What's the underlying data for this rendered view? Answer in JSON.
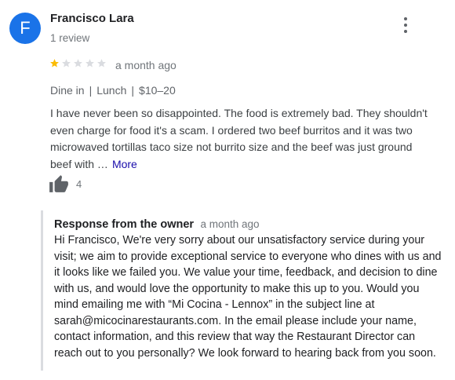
{
  "reviewer": {
    "initial": "F",
    "name": "Francisco Lara",
    "review_count": "1 review",
    "avatar_color": "#1a73e8"
  },
  "review": {
    "rating": 1,
    "max_rating": 5,
    "time": "a month ago",
    "meta": [
      "Dine in",
      "Lunch",
      "$10–20"
    ],
    "meta_separator": "|",
    "text": "I have never been so disappointed. The food is extremely bad. They shouldn't even charge for food it's a scam. I ordered two beef burritos and it was two microwaved tortillas taco size not burrito size and the beef was just ground beef with …",
    "more_label": "More",
    "likes": "4"
  },
  "owner_response": {
    "title": "Response from the owner",
    "time": "a month ago",
    "text": "Hi Francisco, We're very sorry about our unsatisfactory service during your visit; we aim to provide exceptional service to everyone who dines with us and it looks like we failed you. We value your time, feedback, and decision to dine with us, and would love the opportunity to make this up to you. Would you mind emailing me with “Mi Cocina - Lennox” in the subject line at sarah@micocinarestaurants.com. In the email please include your name, contact information, and this review that way the Restaurant Director can reach out to you personally? We look forward to hearing back from you soon."
  },
  "icons": {
    "menu": "more-vert-icon",
    "star_filled": "star-filled-icon",
    "star_empty": "star-empty-icon",
    "like": "thumbs-up-icon"
  },
  "colors": {
    "star_filled": "#fbbc04",
    "star_empty": "#dadce0",
    "link": "#1a0dab",
    "secondary_text": "#70757a"
  }
}
